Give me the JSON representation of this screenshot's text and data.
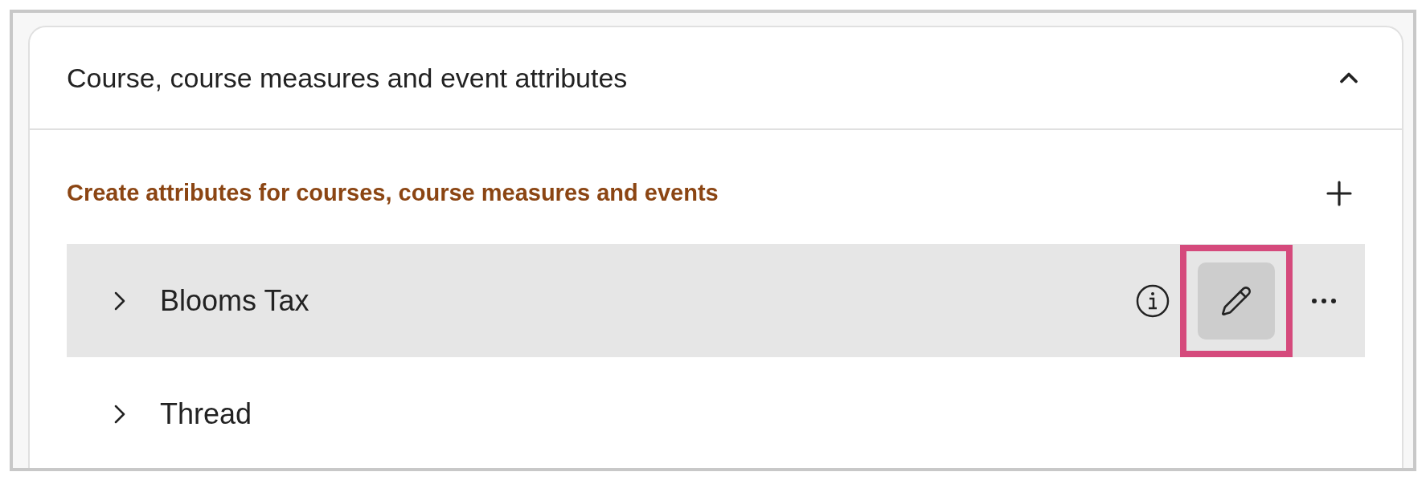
{
  "panel": {
    "title": "Course, course measures and event attributes",
    "expanded": true
  },
  "section": {
    "title": "Create attributes for courses, course measures and events"
  },
  "rows": [
    {
      "label": "Blooms Tax",
      "selected": true,
      "edit_highlighted": true
    },
    {
      "label": "Thread",
      "selected": false
    }
  ]
}
